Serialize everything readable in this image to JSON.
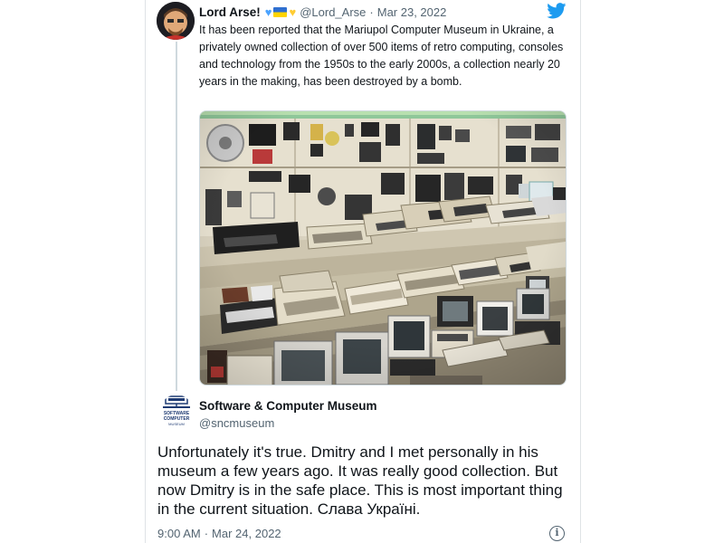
{
  "original_tweet": {
    "author_name": "Lord Arse!",
    "emoji": [
      "blue-heart",
      "ukraine-flag",
      "yellow-heart"
    ],
    "handle": "@Lord_Arse",
    "separator": "·",
    "date": "Mar 23, 2022",
    "text": "It has been reported that the Mariupol Computer Museum in Ukraine, a privately owned collection of over 500 items of retro computing, consoles and technology from the 1950s to the early 2000s, a collection nearly 20 years in the making, has been destroyed by a bomb.",
    "photo_icon": "museum-photo"
  },
  "reply_tweet": {
    "author_name": "Software & Computer Museum",
    "handle": "@sncmuseum",
    "avatar_logo_text": [
      "SOFTWARE",
      "COMPUTER",
      "MUSEUM"
    ],
    "text": "Unfortunately it's true. Dmitry and I met personally in his museum a few years ago. It was really good collection. But now Dmitry is in the safe place. This is most important thing in the current situation. Слава Україні.",
    "time": "9:00 AM",
    "separator": "·",
    "date": "Mar 24, 2022",
    "info_icon_glyph": "i"
  },
  "colors": {
    "twitter_blue": "#1d9bf0",
    "text_primary": "#0f1419",
    "text_secondary": "#536471",
    "border": "#cfd9de",
    "blue_heart": "#4aa3ff",
    "yellow_heart": "#ffcc33"
  }
}
